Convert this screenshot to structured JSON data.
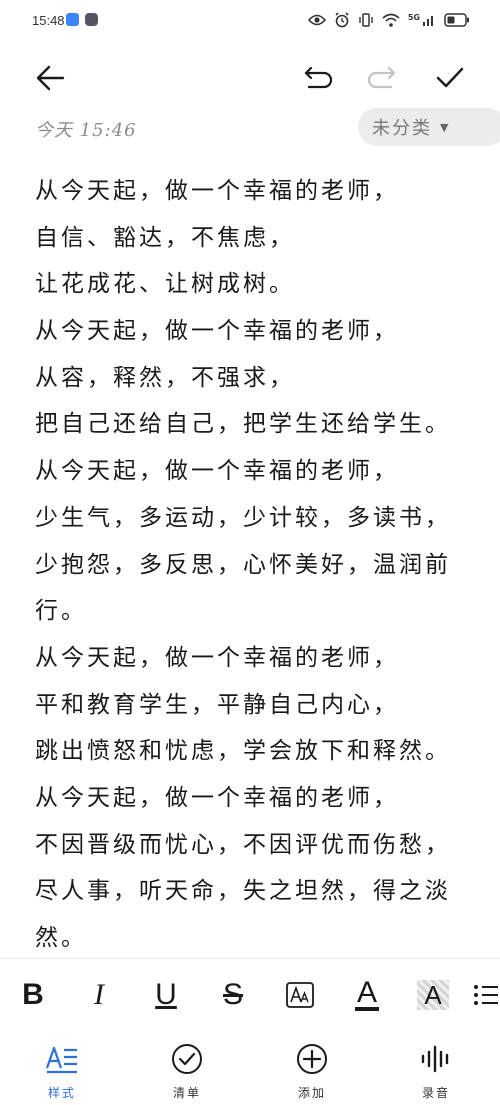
{
  "status_bar": {
    "time": "15:48",
    "network": "5G"
  },
  "toolbar": {
    "back_icon": "arrow-left-icon",
    "undo_icon": "undo-icon",
    "redo_icon": "redo-icon",
    "confirm_icon": "check-icon"
  },
  "note": {
    "date": "今天 15:46",
    "category": "未分类",
    "lines": [
      "从今天起，做一个幸福的老师，",
      "自信、豁达，不焦虑，",
      "让花成花、让树成树。",
      "从今天起，做一个幸福的老师，",
      "从容，释然，不强求，",
      "把自己还给自己，把学生还给学生。",
      "从今天起，做一个幸福的老师，",
      "少生气，多运动，少计较，多读书，",
      "少抱怨，多反思，心怀美好，温润前",
      "行。",
      "从今天起，做一个幸福的老师，",
      "平和教育学生，平静自己内心，",
      "跳出愤怒和忧虑，学会放下和释然。",
      "从今天起，做一个幸福的老师，",
      "不因晋级而忧心，不因评优而伤愁，",
      "尽人事，听天命，失之坦然，得之淡",
      "然。"
    ]
  },
  "format_bar": {
    "bold": "B",
    "italic": "I",
    "underline": "U",
    "strike": "S",
    "text_color": "A",
    "highlight": "A"
  },
  "bottom_nav": {
    "items": [
      {
        "label": "样式",
        "icon": "text-style-icon",
        "active": true
      },
      {
        "label": "清单",
        "icon": "checklist-icon",
        "active": false
      },
      {
        "label": "添加",
        "icon": "add-icon",
        "active": false
      },
      {
        "label": "录音",
        "icon": "voice-record-icon",
        "active": false
      }
    ]
  },
  "colors": {
    "accent": "#2f6fe0",
    "chip_bg": "#ececec",
    "meta_text": "#8c8c8c"
  }
}
